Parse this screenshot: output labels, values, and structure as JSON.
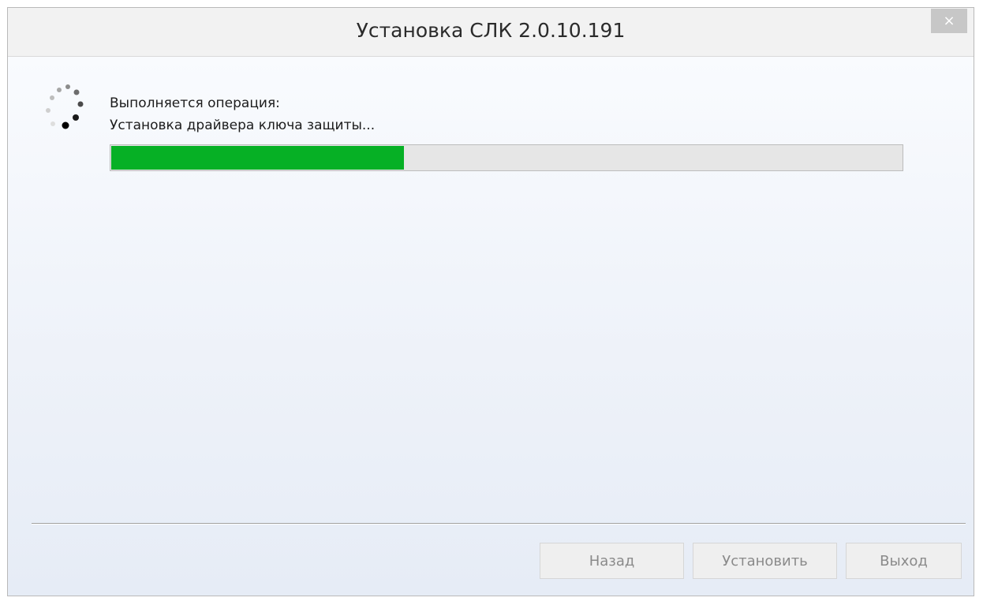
{
  "window": {
    "title": "Установка СЛК 2.0.10.191",
    "close_label": "×"
  },
  "status": {
    "line1": "Выполняется операция:",
    "line2": "Установка драйвера ключа защиты..."
  },
  "progress": {
    "fraction": 0.37,
    "color": "#06b025"
  },
  "buttons": {
    "back": "Назад",
    "install": "Установить",
    "exit": "Выход"
  },
  "icons": {
    "spinner": "busy-spinner-icon",
    "close": "close-icon"
  }
}
